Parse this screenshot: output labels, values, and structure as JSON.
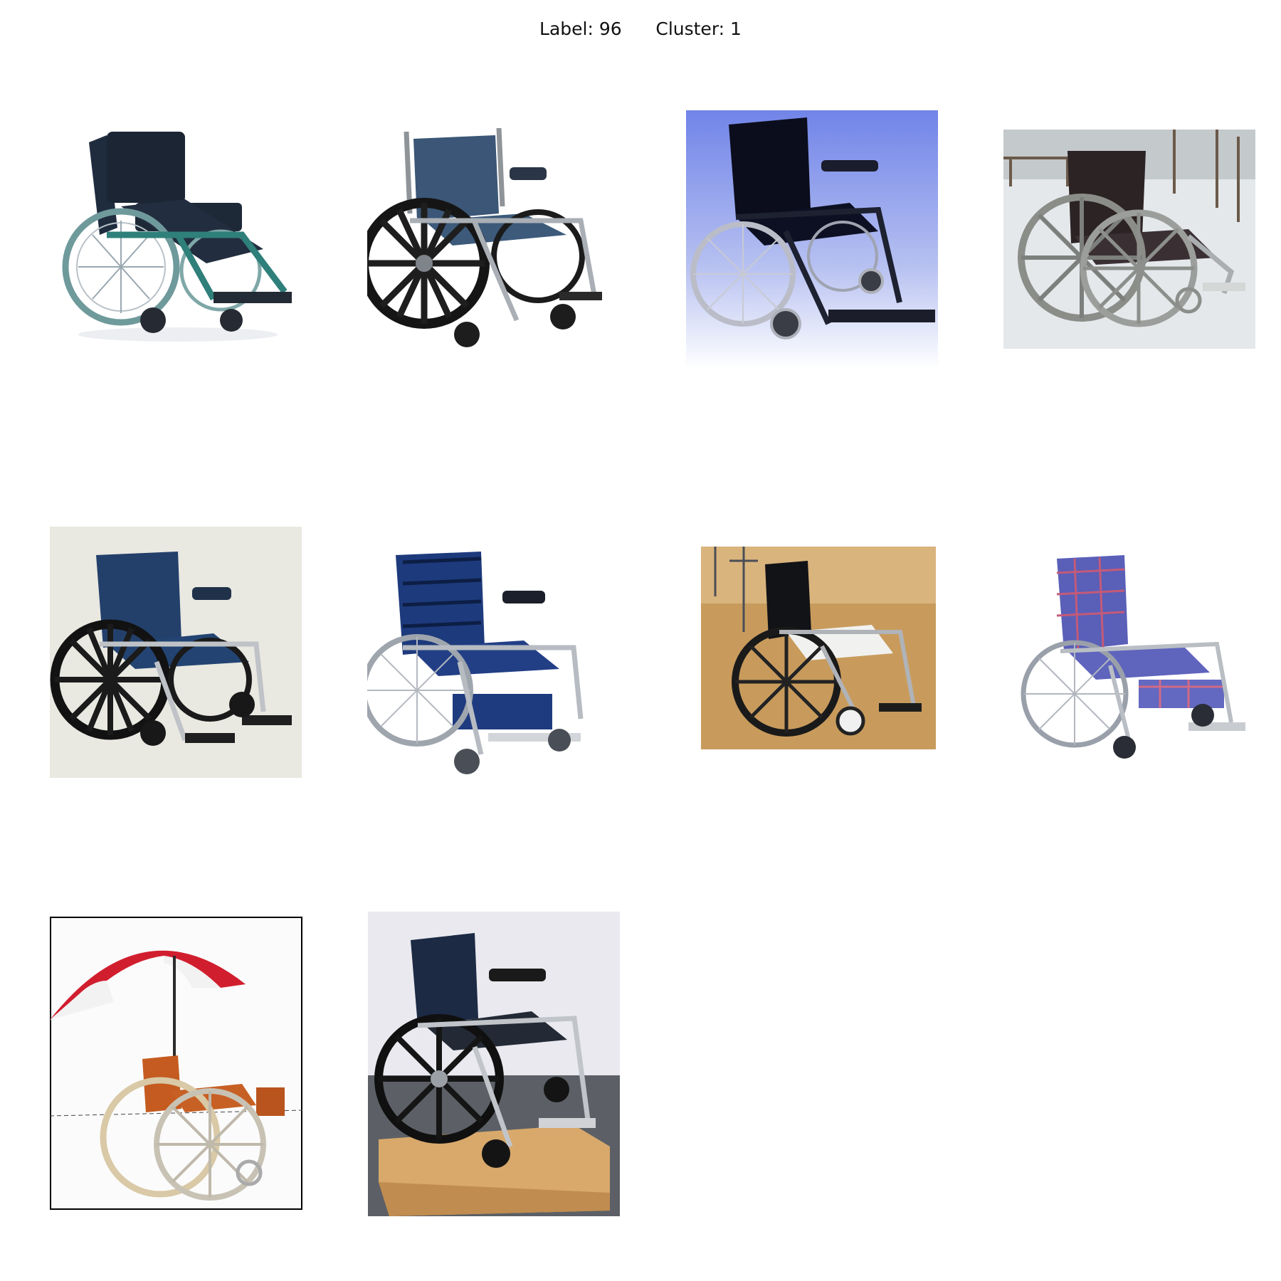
{
  "header": {
    "label_text": "Label: 96",
    "cluster_text": "Cluster: 1"
  },
  "thumbnails": [
    {
      "frame": "teal-frame-black-seat-wheelchair",
      "background": "#ffffff"
    },
    {
      "frame": "chrome-frame-blue-seat-wheelchair",
      "background": "#ffffff"
    },
    {
      "frame": "black-wheelchair",
      "background": "#7f8fe6"
    },
    {
      "frame": "gray-wheelchair",
      "background": "#e6e9ec"
    },
    {
      "frame": "blue-seat-wheelchair",
      "background": "#e9e8e2"
    },
    {
      "frame": "blue-plaid-wheelchair",
      "background": "#ffffff"
    },
    {
      "frame": "black-wheelchair-carpet",
      "background": "#c79a5a"
    },
    {
      "frame": "plaid-seat-wheelchair",
      "background": "#ffffff"
    },
    {
      "frame": "wheelchair-with-umbrella",
      "background": "#fbfbfb"
    },
    {
      "frame": "wheelchair-on-wood-base",
      "background": "#e8e8ee"
    }
  ]
}
